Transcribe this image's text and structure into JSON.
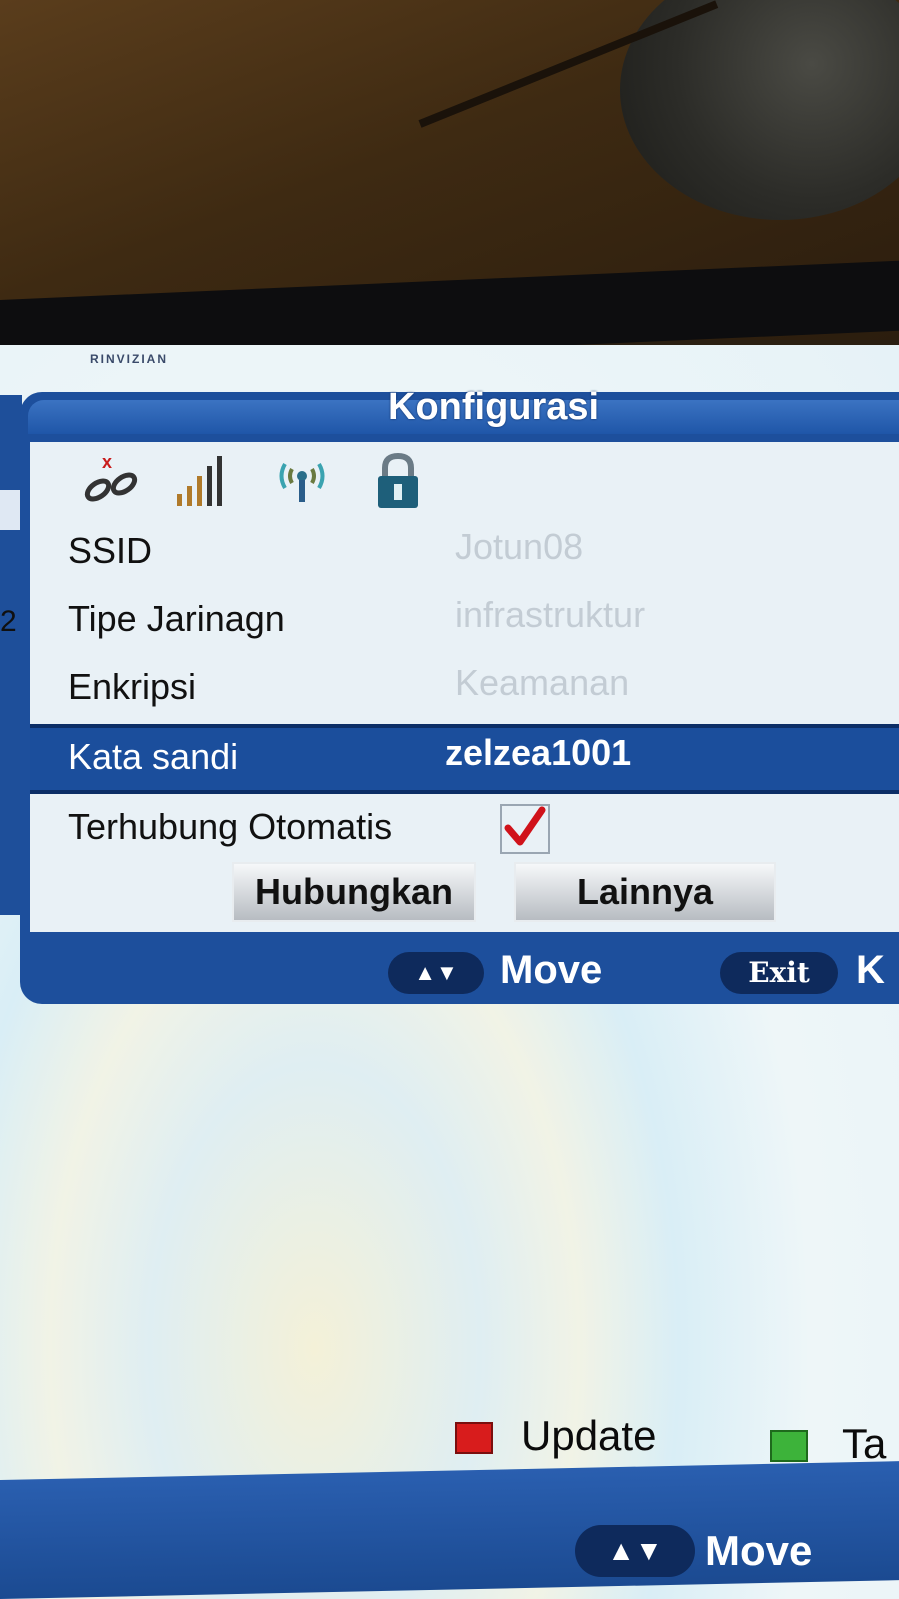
{
  "top_strip_text": "RINVIZIAN",
  "left_stub_number": "2",
  "dialog": {
    "title": "Konfigurasi",
    "status_icons": [
      "link-broken-icon",
      "signal-bars-icon",
      "wifi-antenna-icon",
      "lock-icon"
    ],
    "fields": [
      {
        "label": "SSID",
        "value": "Jotun08"
      },
      {
        "label": "Tipe Jarinagn",
        "value": "infrastruktur"
      },
      {
        "label": "Enkripsi",
        "value": "Keamanan"
      },
      {
        "label": "Kata sandi",
        "value": "zelzea1001",
        "selected": true
      }
    ],
    "auto_connect": {
      "label": "Terhubung Otomatis",
      "checked": true
    },
    "buttons": {
      "connect": "Hubungkan",
      "other": "Lainnya"
    },
    "footer": {
      "move_key": "▲▼",
      "move_label": "Move",
      "exit_key": "Exit",
      "exit_label": "K"
    }
  },
  "legend": {
    "red_label": "Update",
    "green_label": "Ta"
  },
  "bottom_bar": {
    "move_key": "▲▼",
    "move_label": "Move"
  },
  "colors": {
    "dialog_blue": "#1d4f9c",
    "selected_row": "#1b4e9c",
    "check_red": "#d0121a",
    "legend_red": "#d81c1c",
    "legend_green": "#3db33a"
  }
}
